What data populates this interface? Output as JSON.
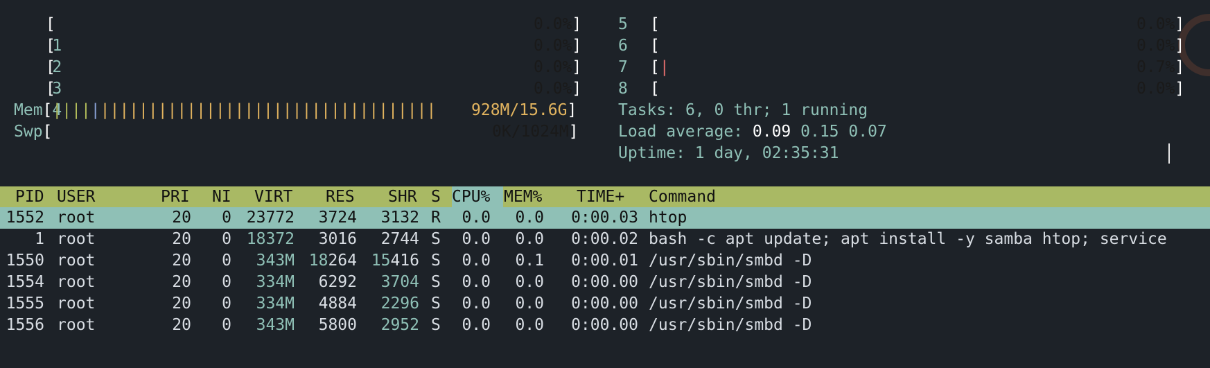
{
  "cpus": [
    {
      "label": "1",
      "value": "0.0%"
    },
    {
      "label": "2",
      "value": "0.0%"
    },
    {
      "label": "3",
      "value": "0.0%"
    },
    {
      "label": "4",
      "value": "0.0%"
    },
    {
      "label": "5",
      "value": "0.0%"
    },
    {
      "label": "6",
      "value": "0.0%"
    },
    {
      "label": "7",
      "value": "0.7%"
    },
    {
      "label": "8",
      "value": "0.0%"
    }
  ],
  "mem": {
    "label": "Mem",
    "value": "928M/15.6G"
  },
  "swp": {
    "label": "Swp",
    "value": "0K/1024M"
  },
  "tasks": {
    "label": "Tasks:",
    "value": "6, 0 thr; 1 running"
  },
  "load": {
    "label": "Load average:",
    "v1": "0.09",
    "v2": "0.15",
    "v3": "0.07"
  },
  "uptime": {
    "label": "Uptime:",
    "value": "1 day, 02:35:31"
  },
  "columns": {
    "pid": "PID",
    "user": "USER",
    "pri": "PRI",
    "ni": "NI",
    "virt": "VIRT",
    "res": "RES",
    "shr": "SHR",
    "s": "S",
    "cpu": "CPU%",
    "mem": "MEM%",
    "time": "TIME+",
    "command": "Command"
  },
  "processes": [
    {
      "pid": "1552",
      "user": "root",
      "pri": "20",
      "ni": "0",
      "virt": "23772",
      "res": "3724",
      "shr": "3132",
      "s": "R",
      "cpu": "0.0",
      "mem": "0.0",
      "time": "0:00.03",
      "command": "htop"
    },
    {
      "pid": "1",
      "user": "root",
      "pri": "20",
      "ni": "0",
      "virt": "18372",
      "res": "3016",
      "shr": "2744",
      "s": "S",
      "cpu": "0.0",
      "mem": "0.0",
      "time": "0:00.02",
      "command": "bash -c apt update; apt install -y samba htop; service"
    },
    {
      "pid": "1550",
      "user": "root",
      "pri": "20",
      "ni": "0",
      "virt": "343M",
      "res": "18264",
      "shr": "15416",
      "s": "S",
      "cpu": "0.0",
      "mem": "0.1",
      "time": "0:00.01",
      "command": "/usr/sbin/smbd -D"
    },
    {
      "pid": "1554",
      "user": "root",
      "pri": "20",
      "ni": "0",
      "virt": "334M",
      "res": "6292",
      "shr": "3704",
      "s": "S",
      "cpu": "0.0",
      "mem": "0.0",
      "time": "0:00.00",
      "command": "/usr/sbin/smbd -D"
    },
    {
      "pid": "1555",
      "user": "root",
      "pri": "20",
      "ni": "0",
      "virt": "334M",
      "res": "4884",
      "shr": "2296",
      "s": "S",
      "cpu": "0.0",
      "mem": "0.0",
      "time": "0:00.00",
      "command": "/usr/sbin/smbd -D"
    },
    {
      "pid": "1556",
      "user": "root",
      "pri": "20",
      "ni": "0",
      "virt": "343M",
      "res": "5800",
      "shr": "2952",
      "s": "S",
      "cpu": "0.0",
      "mem": "0.0",
      "time": "0:00.00",
      "command": "/usr/sbin/smbd -D"
    }
  ]
}
